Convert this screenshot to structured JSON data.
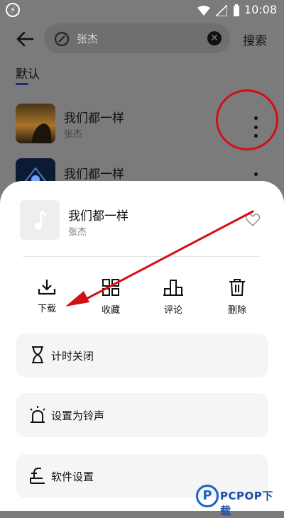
{
  "status_bar": {
    "time": "10:08"
  },
  "search": {
    "query": "张杰",
    "button_label": "搜索"
  },
  "tabs": {
    "default_label": "默认"
  },
  "results": [
    {
      "title": "我们都一样",
      "artist": "张杰"
    },
    {
      "title": "我们都一样"
    }
  ],
  "sheet": {
    "song_title": "我们都一样",
    "artist": "张杰",
    "actions": [
      {
        "label": "下载",
        "icon": "download-icon"
      },
      {
        "label": "收藏",
        "icon": "grid-icon"
      },
      {
        "label": "评论",
        "icon": "comment-icon"
      },
      {
        "label": "删除",
        "icon": "trash-icon"
      }
    ],
    "menu": [
      {
        "label": "计时关闭",
        "icon": "hourglass-icon"
      },
      {
        "label": "设置为铃声",
        "icon": "alarm-icon"
      },
      {
        "label": "软件设置",
        "icon": "settings-icon"
      }
    ]
  },
  "watermark": {
    "text": "PCPOP下载"
  },
  "colors": {
    "accent": "#1b2e70",
    "annotation_red": "#d40f14",
    "watermark_blue": "#1a63c8"
  }
}
